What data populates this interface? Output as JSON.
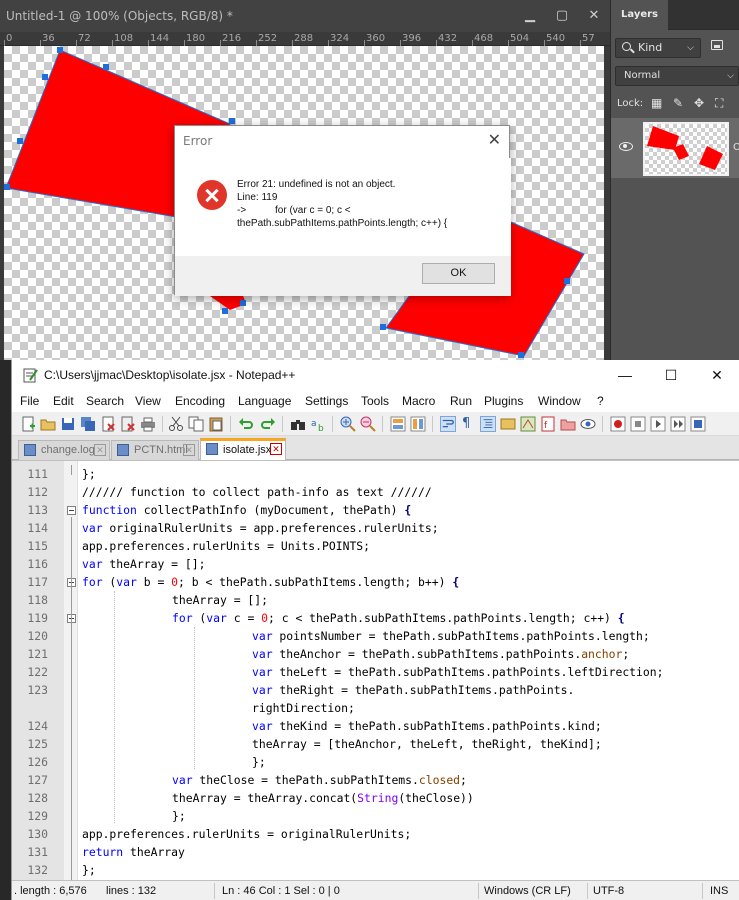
{
  "photoshop": {
    "doc_title": "Untitled-1 @ 100% (Objects, RGB/8) *",
    "ruler_ticks": [
      "0",
      "36",
      "72",
      "108",
      "144",
      "180",
      "216",
      "252",
      "288",
      "324",
      "360",
      "396",
      "432",
      "468",
      "504",
      "540",
      "57"
    ],
    "window_controls": {
      "minimize": "▁",
      "restore": "▢",
      "close": "✕"
    }
  },
  "layers_panel": {
    "tab": "Layers",
    "filter_kind": "Kind",
    "blend_mode": "Normal",
    "lock_label": "Lock:",
    "lock_icons": [
      "▦",
      "✎",
      "✥",
      "⛶"
    ],
    "layer_name_cut": "O"
  },
  "error_dialog": {
    "title": "Error",
    "close": "✕",
    "message": "Error 21: undefined is not an object.",
    "line_label": "Line: 119",
    "arrow": "->",
    "code_line_1": "for (var c = 0; c <",
    "code_line_2": "thePath.subPathItems.pathPoints.length; c++) {",
    "ok_label": "OK"
  },
  "notepad": {
    "title": "C:\\Users\\jjmac\\Desktop\\isolate.jsx - Notepad++",
    "window_controls": {
      "minimize": "—",
      "maximize": "☐",
      "close": "✕"
    },
    "menu": [
      "File",
      "Edit",
      "Search",
      "View",
      "Encoding",
      "Language",
      "Settings",
      "Tools",
      "Macro",
      "Run",
      "Plugins",
      "Window",
      "?"
    ],
    "tabs": [
      {
        "label": "change.log",
        "active": false
      },
      {
        "label": "PCTN.html",
        "active": false
      },
      {
        "label": "isolate.jsx",
        "active": true
      }
    ],
    "tab_close": "✕",
    "line_numbers": [
      "111",
      "112",
      "113",
      "114",
      "115",
      "116",
      "117",
      "118",
      "119",
      "120",
      "121",
      "122",
      "123",
      "",
      "124",
      "125",
      "126",
      "127",
      "128",
      "129",
      "130",
      "131",
      "132"
    ],
    "code": [
      "};",
      "////// function to collect path-info as text //////",
      "function collectPathInfo (myDocument, thePath) {",
      "var originalRulerUnits = app.preferences.rulerUnits;",
      "app.preferences.rulerUnits = Units.POINTS;",
      "var theArray = [];",
      "for (var b = 0; b < thePath.subPathItems.length; b++) {",
      "theArray = [];",
      "for (var c = 0; c < thePath.subPathItems.pathPoints.length; c++) {",
      "var pointsNumber = thePath.subPathItems.pathPoints.length;",
      "var theAnchor = thePath.subPathItems.pathPoints.anchor;",
      "var theLeft = thePath.subPathItems.pathPoints.leftDirection;",
      "var theRight = thePath.subPathItems.pathPoints.",
      "rightDirection;",
      "var theKind = thePath.subPathItems.pathPoints.kind;",
      "theArray = [theAnchor, theLeft, theRight, theKind];",
      "};",
      "var theClose = thePath.subPathItems.closed;",
      "theArray = theArray.concat(String(theClose))",
      "};",
      "app.preferences.rulerUnits = originalRulerUnits;",
      "return theArray",
      "};"
    ],
    "status": {
      "length": ". length : 6,576",
      "lines": "lines : 132",
      "position": "Ln : 46   Col : 1   Sel : 0 | 0",
      "eol": "Windows (CR LF)",
      "encoding": "UTF-8",
      "mode": "INS"
    }
  },
  "colors": {
    "shape_red": "#ff0000",
    "anchor_blue": "#1e6fd9",
    "error_icon": "#e0352b",
    "active_tab_accent": "#f5a623"
  }
}
